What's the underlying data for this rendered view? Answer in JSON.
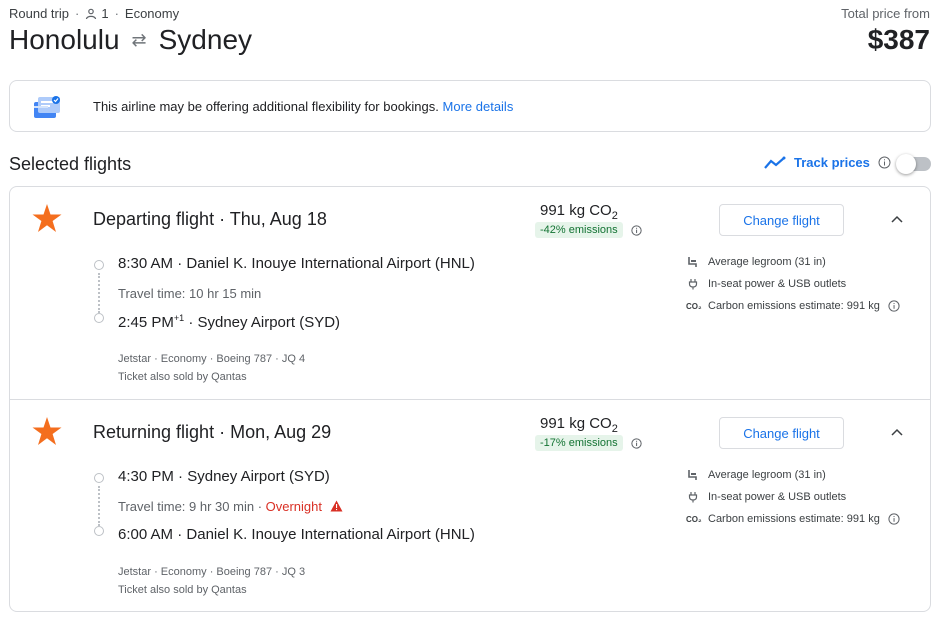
{
  "header": {
    "trip_type": "Round trip",
    "passengers": "1",
    "cabin": "Economy",
    "origin": "Honolulu",
    "destination": "Sydney",
    "total_label": "Total price from",
    "total_price": "$387"
  },
  "notice": {
    "text": "This airline may be offering additional flexibility for bookings.",
    "link": "More details"
  },
  "section": {
    "title": "Selected flights",
    "track_label": "Track prices"
  },
  "legs": [
    {
      "title": "Departing flight",
      "date": "Thu, Aug 18",
      "co2_value": "991 kg CO",
      "co2_sub": "2",
      "emissions_badge": "-42% emissions",
      "change_label": "Change flight",
      "dep_time": "8:30 AM",
      "dep_airport": "Daniel K. Inouye International Airport (HNL)",
      "travel_time": "Travel time: 10 hr 15 min",
      "overnight": "",
      "arr_time": "2:45 PM",
      "arr_plus": "+1",
      "arr_airport": "Sydney Airport (SYD)",
      "details": "Jetstar · Economy · Boeing 787 · JQ 4",
      "sold_by": "Ticket also sold by Qantas",
      "amenities": {
        "legroom": "Average legroom (31 in)",
        "power": "In-seat power & USB outlets",
        "carbon": "Carbon emissions estimate: 991 kg"
      }
    },
    {
      "title": "Returning flight",
      "date": "Mon, Aug 29",
      "co2_value": "991 kg CO",
      "co2_sub": "2",
      "emissions_badge": "-17% emissions",
      "change_label": "Change flight",
      "dep_time": "4:30 PM",
      "dep_airport": "Sydney Airport (SYD)",
      "travel_time": "Travel time: 9 hr 30 min",
      "overnight": "Overnight",
      "arr_time": "6:00 AM",
      "arr_plus": "",
      "arr_airport": "Daniel K. Inouye International Airport (HNL)",
      "details": "Jetstar · Economy · Boeing 787 · JQ 3",
      "sold_by": "Ticket also sold by Qantas",
      "amenities": {
        "legroom": "Average legroom (31 in)",
        "power": "In-seat power & USB outlets",
        "carbon": "Carbon emissions estimate: 991 kg"
      }
    }
  ],
  "icons": {
    "airline": "jetstar-star-icon",
    "notice": "booking-flexibility-icon",
    "track": "trend-line-icon",
    "legroom": "seat-icon",
    "power": "plug-icon",
    "carbon": "co2-icon",
    "info": "info-icon",
    "chevron": "chevron-up-icon",
    "warning": "warning-icon"
  },
  "colors": {
    "accent": "#1a73e8",
    "airline": "#f46e1e",
    "emissions_bg": "#e6f4ea",
    "emissions_text": "#137333",
    "warning": "#d93025"
  }
}
